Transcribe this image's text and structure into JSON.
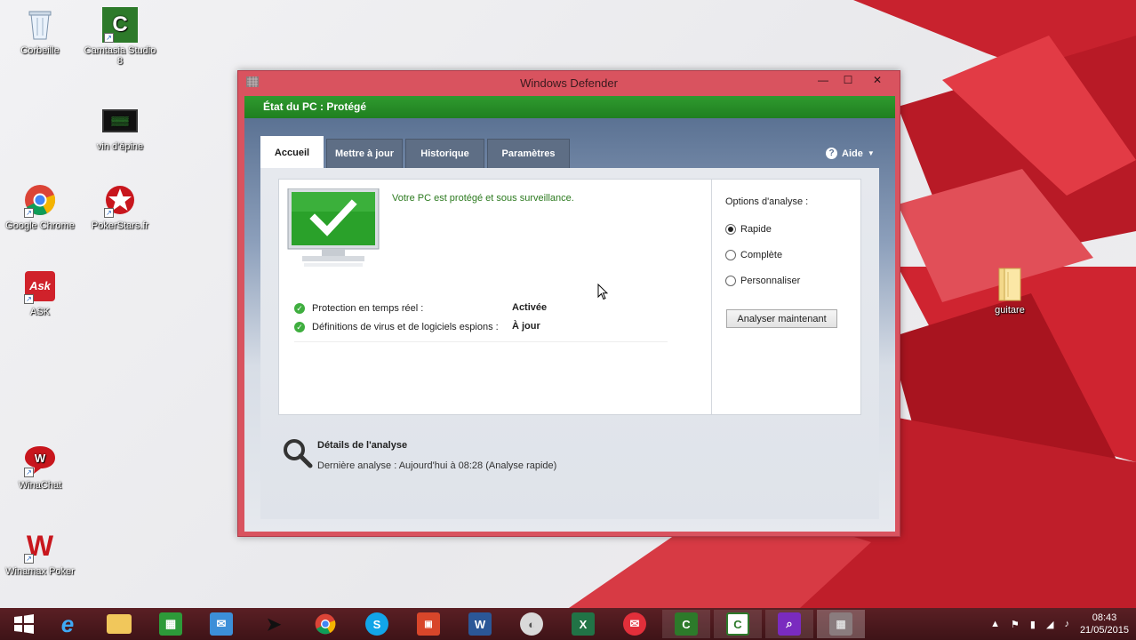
{
  "desktop": {
    "icons": [
      {
        "label": "Corbeille"
      },
      {
        "label": "Camtasia Studio 8"
      },
      {
        "label": "vin d'épine"
      },
      {
        "label": "Google Chrome"
      },
      {
        "label": "PokerStars.fr"
      },
      {
        "label": "ASK"
      },
      {
        "label": "guitare"
      },
      {
        "label": "WinaChat"
      },
      {
        "label": "Winamax Poker"
      }
    ]
  },
  "window": {
    "title": "Windows Defender",
    "status": "État du PC : Protégé",
    "tabs": [
      {
        "label": "Accueil",
        "active": true
      },
      {
        "label": "Mettre à jour"
      },
      {
        "label": "Historique"
      },
      {
        "label": "Paramètres"
      }
    ],
    "help_label": "Aide",
    "status_message": "Votre PC est protégé et sous surveillance.",
    "protection": [
      {
        "label": "Protection en temps réel :",
        "value": "Activée"
      },
      {
        "label": "Définitions de virus et de logiciels espions :",
        "value": "À jour"
      }
    ],
    "scan_options": {
      "title": "Options d'analyse :",
      "options": [
        {
          "label": "Rapide",
          "selected": true
        },
        {
          "label": "Complète"
        },
        {
          "label": "Personnaliser"
        }
      ],
      "button": "Analyser maintenant"
    },
    "details": {
      "title": "Détails de l'analyse",
      "last_scan": "Dernière analyse : Aujourd'hui à 08:28 (Analyse rapide)"
    }
  },
  "taskbar": {
    "clock_time": "08:43",
    "clock_date": "21/05/2015"
  },
  "colors": {
    "status_green": "#2f9a2f",
    "title_bar": "#d9535f",
    "taskbar": "#4a171b"
  }
}
